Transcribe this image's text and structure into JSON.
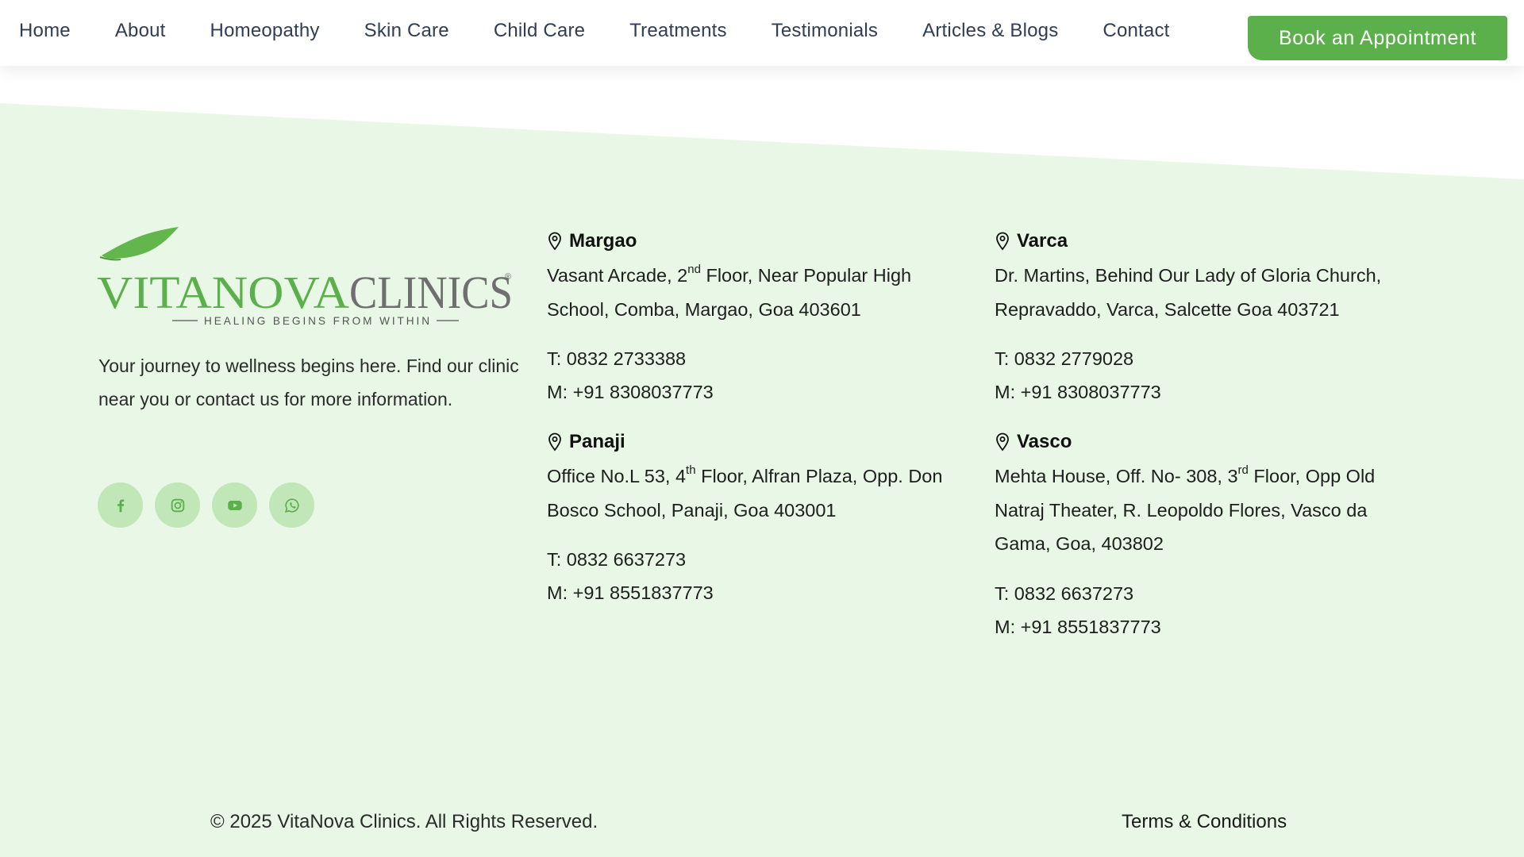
{
  "nav": {
    "items": [
      "Home",
      "About",
      "Homeopathy",
      "Skin Care",
      "Child Care",
      "Treatments",
      "Testimonials",
      "Articles & Blogs",
      "Contact"
    ],
    "cta": "Book an Appointment"
  },
  "colors": {
    "brand_green": "#5cb04b",
    "footer_bg": "#e8f7e6",
    "social_bg": "#c1e6b8",
    "nav_text": "#2f3d55"
  },
  "footer": {
    "logo": {
      "main": "VITANOVACLINICS",
      "tagline": "HEALING BEGINS FROM WITHIN",
      "mark": "®"
    },
    "description": "Your journey to wellness begins here. Find our clinic near you or contact us for more information.",
    "socials": [
      "facebook-icon",
      "instagram-icon",
      "youtube-icon",
      "whatsapp-icon"
    ],
    "clinics": {
      "margao": {
        "name": "Margao",
        "addr_pre": "Vasant Arcade, 2",
        "addr_sup": "nd",
        "addr_post": " Floor, Near Popular High School, Comba, Margao, Goa 403601",
        "tel": "T: 0832 2733388",
        "mob": "M: +91 8308037773"
      },
      "varca": {
        "name": "Varca",
        "addr_pre": "Dr. Martins, Behind Our Lady of Gloria Church, Repravaddo, Varca, Salcette Goa 403721",
        "addr_sup": "",
        "addr_post": "",
        "tel": "T: 0832 2779028",
        "mob": "M: +91 8308037773"
      },
      "panaji": {
        "name": "Panaji",
        "addr_pre": "Office No.L 53, 4",
        "addr_sup": "th",
        "addr_post": " Floor, Alfran Plaza, Opp. Don Bosco School, Panaji, Goa 403001",
        "tel": "T: 0832 6637273",
        "mob": "M: +91 8551837773"
      },
      "vasco": {
        "name": "Vasco",
        "addr_pre": "Mehta House, Off. No- 308, 3",
        "addr_sup": "rd",
        "addr_post": " Floor, Opp Old Natraj Theater, R. Leopoldo Flores, Vasco da Gama, Goa, 403802",
        "tel": "T: 0832 6637273",
        "mob": "M: +91 8551837773"
      }
    },
    "copyright": "© 2025 VitaNova Clinics. All Rights Reserved.",
    "terms": "Terms & Conditions"
  }
}
